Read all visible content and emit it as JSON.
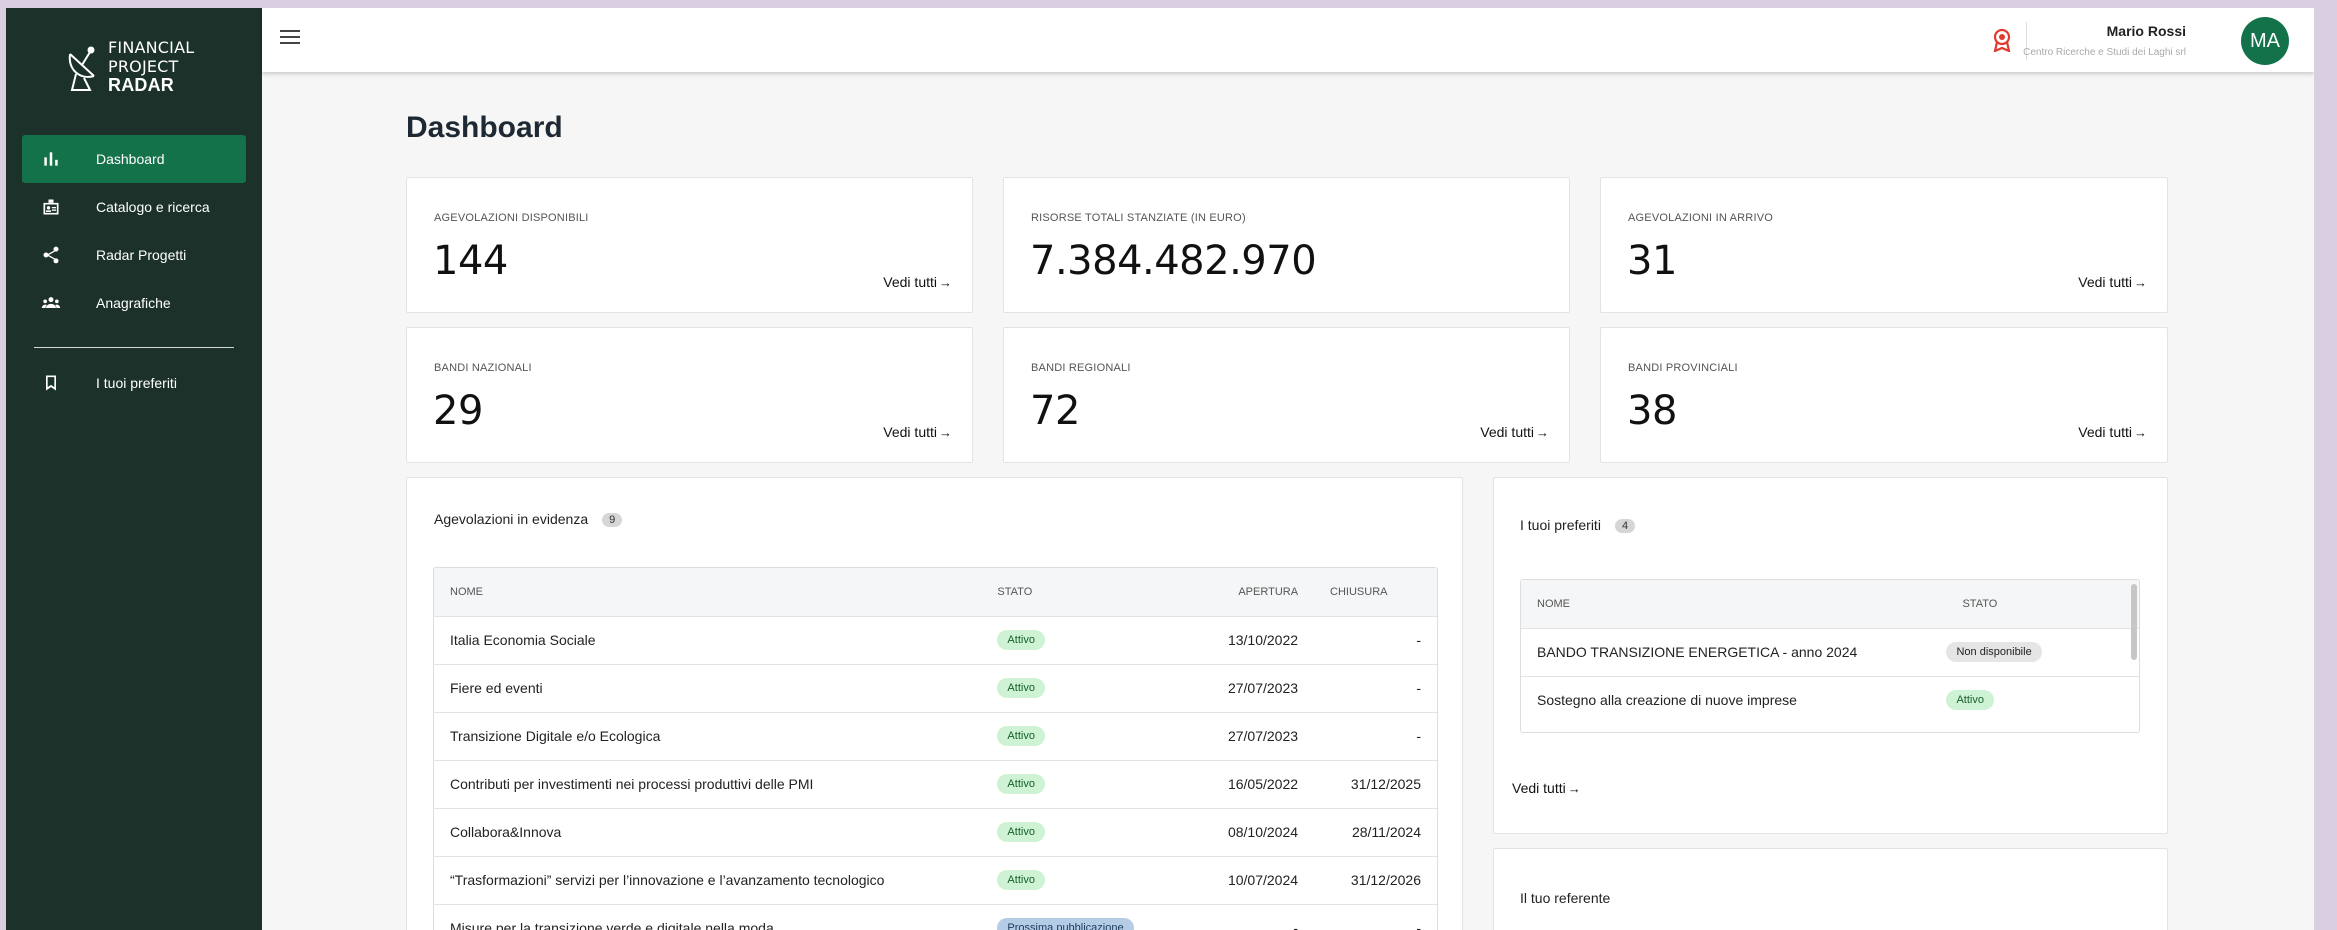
{
  "app": {
    "logo": {
      "line1": "FINANCIAL",
      "line2": "PROJECT",
      "line3": "RADAR"
    }
  },
  "sidebar": {
    "items": [
      {
        "label": "Dashboard",
        "icon": "bar-chart-icon"
      },
      {
        "label": "Catalogo e ricerca",
        "icon": "badge-icon"
      },
      {
        "label": "Radar Progetti",
        "icon": "share-icon"
      },
      {
        "label": "Anagrafiche",
        "icon": "people-icon"
      }
    ],
    "favorites": {
      "label": "I tuoi preferiti",
      "icon": "bookmark-icon"
    }
  },
  "header": {
    "user_name": "Mario Rossi",
    "user_org": "Centro Ricerche e Studi dei Laghi srl",
    "avatar_initials": "MA"
  },
  "page": {
    "title": "Dashboard"
  },
  "stats": [
    {
      "label": "AGEVOLAZIONI DISPONIBILI",
      "value": "144",
      "link": "Vedi tutti"
    },
    {
      "label": "RISORSE TOTALI STANZIATE (IN EURO)",
      "value": "7.384.482.970",
      "link": ""
    },
    {
      "label": "AGEVOLAZIONI IN ARRIVO",
      "value": "31",
      "link": "Vedi tutti"
    },
    {
      "label": "BANDI NAZIONALI",
      "value": "29",
      "link": "Vedi tutti"
    },
    {
      "label": "BANDI REGIONALI",
      "value": "72",
      "link": "Vedi tutti"
    },
    {
      "label": "BANDI PROVINCIALI",
      "value": "38",
      "link": "Vedi tutti"
    }
  ],
  "featured": {
    "title": "Agevolazioni in evidenza",
    "count": "9",
    "columns": [
      "NOME",
      "STATO",
      "APERTURA",
      "CHIUSURA"
    ],
    "rows": [
      {
        "name": "Italia Economia Sociale",
        "status": "Attivo",
        "open": "13/10/2022",
        "close": "-"
      },
      {
        "name": "Fiere ed eventi",
        "status": "Attivo",
        "open": "27/07/2023",
        "close": "-"
      },
      {
        "name": "Transizione Digitale e/o Ecologica",
        "status": "Attivo",
        "open": "27/07/2023",
        "close": "-"
      },
      {
        "name": "Contributi per investimenti nei processi produttivi delle PMI",
        "status": "Attivo",
        "open": "16/05/2022",
        "close": "31/12/2025"
      },
      {
        "name": "Collabora&Innova",
        "status": "Attivo",
        "open": "08/10/2024",
        "close": "28/11/2024"
      },
      {
        "name": "“Trasformazioni” servizi per l’innovazione e l’avanzamento tecnologico",
        "status": "Attivo",
        "open": "10/07/2024",
        "close": "31/12/2026"
      },
      {
        "name": "Misure per la transizione verde e digitale nella moda",
        "status": "Prossima pubblicazione",
        "open": "-",
        "close": "-"
      }
    ]
  },
  "favorites_panel": {
    "title": "I tuoi preferiti",
    "count": "4",
    "columns": [
      "NOME",
      "STATO"
    ],
    "rows": [
      {
        "name": "BANDO TRANSIZIONE ENERGETICA - anno 2024",
        "status": "Non disponibile"
      },
      {
        "name": "Sostegno alla creazione di nuove imprese",
        "status": "Attivo"
      }
    ],
    "link": "Vedi tutti"
  },
  "referent": {
    "title": "Il tuo referente"
  },
  "colors": {
    "sidebar": "#1c3129",
    "accent": "#13724a",
    "active_status": "#cdf3d4"
  }
}
